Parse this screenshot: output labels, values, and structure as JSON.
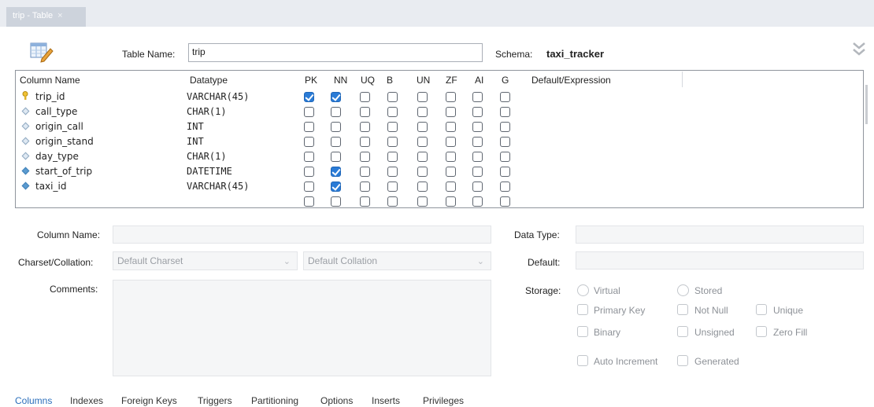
{
  "document_tab": {
    "label": "trip - Table",
    "close": "×"
  },
  "header": {
    "table_name_label": "Table Name:",
    "table_name_value": "trip",
    "schema_label": "Schema:",
    "schema_value": "taxi_tracker"
  },
  "grid": {
    "headers": [
      "Column Name",
      "Datatype",
      "PK",
      "NN",
      "UQ",
      "B",
      "UN",
      "ZF",
      "AI",
      "G",
      "Default/Expression"
    ],
    "rows": [
      {
        "name": "trip_id",
        "datatype": "VARCHAR(45)",
        "icon": "key-icon",
        "flags": [
          1,
          1,
          0,
          0,
          0,
          0,
          0,
          0
        ]
      },
      {
        "name": "call_type",
        "datatype": "CHAR(1)",
        "icon": "diamond-icon",
        "flags": [
          0,
          0,
          0,
          0,
          0,
          0,
          0,
          0
        ]
      },
      {
        "name": "origin_call",
        "datatype": "INT",
        "icon": "diamond-icon",
        "flags": [
          0,
          0,
          0,
          0,
          0,
          0,
          0,
          0
        ]
      },
      {
        "name": "origin_stand",
        "datatype": "INT",
        "icon": "diamond-icon",
        "flags": [
          0,
          0,
          0,
          0,
          0,
          0,
          0,
          0
        ]
      },
      {
        "name": "day_type",
        "datatype": "CHAR(1)",
        "icon": "diamond-icon",
        "flags": [
          0,
          0,
          0,
          0,
          0,
          0,
          0,
          0
        ]
      },
      {
        "name": "start_of_trip",
        "datatype": "DATETIME",
        "icon": "filled-diamond-icon",
        "flags": [
          0,
          1,
          0,
          0,
          0,
          0,
          0,
          0
        ]
      },
      {
        "name": "taxi_id",
        "datatype": "VARCHAR(45)",
        "icon": "filled-diamond-icon",
        "flags": [
          0,
          1,
          0,
          0,
          0,
          0,
          0,
          0
        ]
      }
    ],
    "empty_row_flags": [
      0,
      0,
      0,
      0,
      0,
      0,
      0,
      0
    ]
  },
  "details": {
    "column_name_label": "Column Name:",
    "charset_label": "Charset/Collation:",
    "charset_value": "Default Charset",
    "collation_value": "Default Collation",
    "comments_label": "Comments:",
    "data_type_label": "Data Type:",
    "default_label": "Default:",
    "storage_label": "Storage:",
    "storage_options": [
      "Virtual",
      "Stored"
    ],
    "flag_options": [
      "Primary Key",
      "Not Null",
      "Unique",
      "Binary",
      "Unsigned",
      "Zero Fill",
      "Auto Increment",
      "Generated"
    ]
  },
  "bottom_tabs": [
    "Columns",
    "Indexes",
    "Foreign Keys",
    "Triggers",
    "Partitioning",
    "Options",
    "Inserts",
    "Privileges"
  ],
  "colors": {
    "accent": "#2a7bd6",
    "active_tab": "#2a6ebb",
    "tab_bar": "#e9ecf1"
  }
}
